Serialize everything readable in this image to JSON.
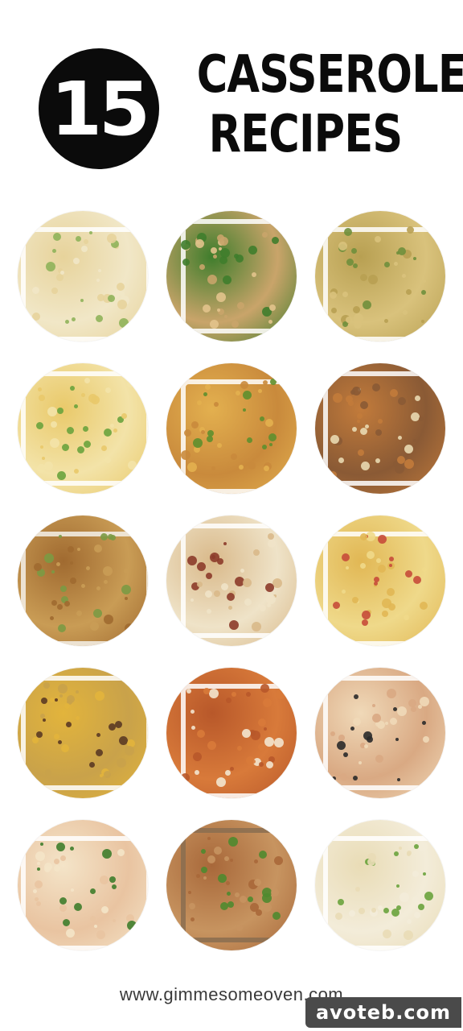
{
  "header": {
    "count": "15",
    "title_line1": "CASSEROLE",
    "title_line2": "RECIPES"
  },
  "recipes": [
    {
      "name": "recipe-1",
      "colors": [
        "#f1e7c7",
        "#e7d39b",
        "#8fb35a",
        "#ffffff"
      ]
    },
    {
      "name": "recipe-2",
      "colors": [
        "#c9a46a",
        "#3f7d2c",
        "#e2c38c",
        "#ffffff"
      ]
    },
    {
      "name": "recipe-3",
      "colors": [
        "#d9c27c",
        "#b8a052",
        "#6f8f3c",
        "#ffffff"
      ]
    },
    {
      "name": "recipe-4",
      "colors": [
        "#f3e3a8",
        "#e9c96a",
        "#6aa33d",
        "#ffffff"
      ]
    },
    {
      "name": "recipe-5",
      "colors": [
        "#c98a3c",
        "#e3b04f",
        "#5e8f2d",
        "#ffffff"
      ]
    },
    {
      "name": "recipe-6",
      "colors": [
        "#8a5a35",
        "#c27b3b",
        "#e9d9b1",
        "#ffffff"
      ]
    },
    {
      "name": "recipe-7",
      "colors": [
        "#c99c55",
        "#a06a30",
        "#7b9a44",
        "#f5f1ea"
      ]
    },
    {
      "name": "recipe-8",
      "colors": [
        "#efe3c8",
        "#d9b98a",
        "#8c3b2a",
        "#ffffff"
      ]
    },
    {
      "name": "recipe-9",
      "colors": [
        "#efd98a",
        "#e1b754",
        "#c64b3a",
        "#ffffff"
      ]
    },
    {
      "name": "recipe-10",
      "colors": [
        "#c9a24a",
        "#e2b43c",
        "#5b3a24",
        "#ffffff"
      ]
    },
    {
      "name": "recipe-11",
      "colors": [
        "#d87a3a",
        "#b8582a",
        "#f3e6cf",
        "#ffffff"
      ]
    },
    {
      "name": "recipe-12",
      "colors": [
        "#d9a983",
        "#f0d9b8",
        "#2a2a2a",
        "#ffffff"
      ]
    },
    {
      "name": "recipe-13",
      "colors": [
        "#e9c4a1",
        "#f4e4c8",
        "#3f7d2c",
        "#ffffff"
      ]
    },
    {
      "name": "recipe-14",
      "colors": [
        "#c79460",
        "#a8683a",
        "#4f8a2f",
        "#8a6d50"
      ]
    },
    {
      "name": "recipe-15",
      "colors": [
        "#f3ecd9",
        "#e9dcb6",
        "#6aa33d",
        "#ffffff"
      ]
    }
  ],
  "footer": {
    "url": "www.gimmesomeoven.com",
    "watermark": "avoteb.com"
  }
}
